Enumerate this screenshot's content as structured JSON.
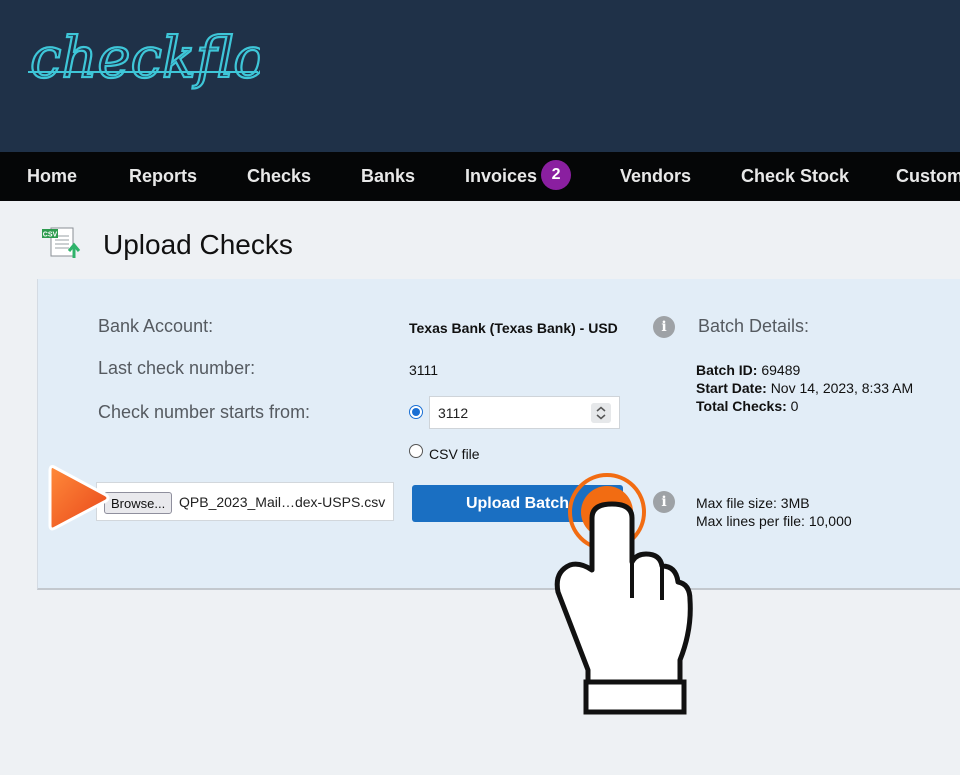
{
  "brand": {
    "logo_text": "checkflo"
  },
  "nav": {
    "items": [
      "Home",
      "Reports",
      "Checks",
      "Banks",
      "Invoices",
      "Vendors",
      "Check Stock",
      "Customers"
    ],
    "invoices_badge": "2"
  },
  "page": {
    "title": "Upload Checks",
    "icon": "csv-upload-icon",
    "icon_text": "CSV"
  },
  "form": {
    "bank_account_label": "Bank Account:",
    "bank_account_value": "Texas Bank (Texas Bank) - USD",
    "last_check_label": "Last check number:",
    "last_check_value": "3111",
    "starts_from_label": "Check number starts from:",
    "starts_from_value": "3112",
    "csv_option_label": "CSV file",
    "browse_label": "Browse...",
    "file_name": "QPB_2023_Mail…dex-USPS.csv",
    "upload_button": "Upload Batch"
  },
  "batch": {
    "heading": "Batch Details:",
    "id_label": "Batch ID:",
    "id_value": "69489",
    "start_label": "Start Date:",
    "start_value": "Nov 14, 2023, 8:33 AM",
    "total_label": "Total Checks:",
    "total_value": "0"
  },
  "limits": {
    "max_size": "Max file size: 3MB",
    "max_lines": "Max lines per file: 10,000"
  },
  "colors": {
    "header_bg": "#1f3148",
    "nav_bg": "#050607",
    "accent_teal": "#3ec6d8",
    "badge": "#8a1fa0",
    "primary_button": "#1a6fc2",
    "highlight_orange": "#f26c12"
  }
}
